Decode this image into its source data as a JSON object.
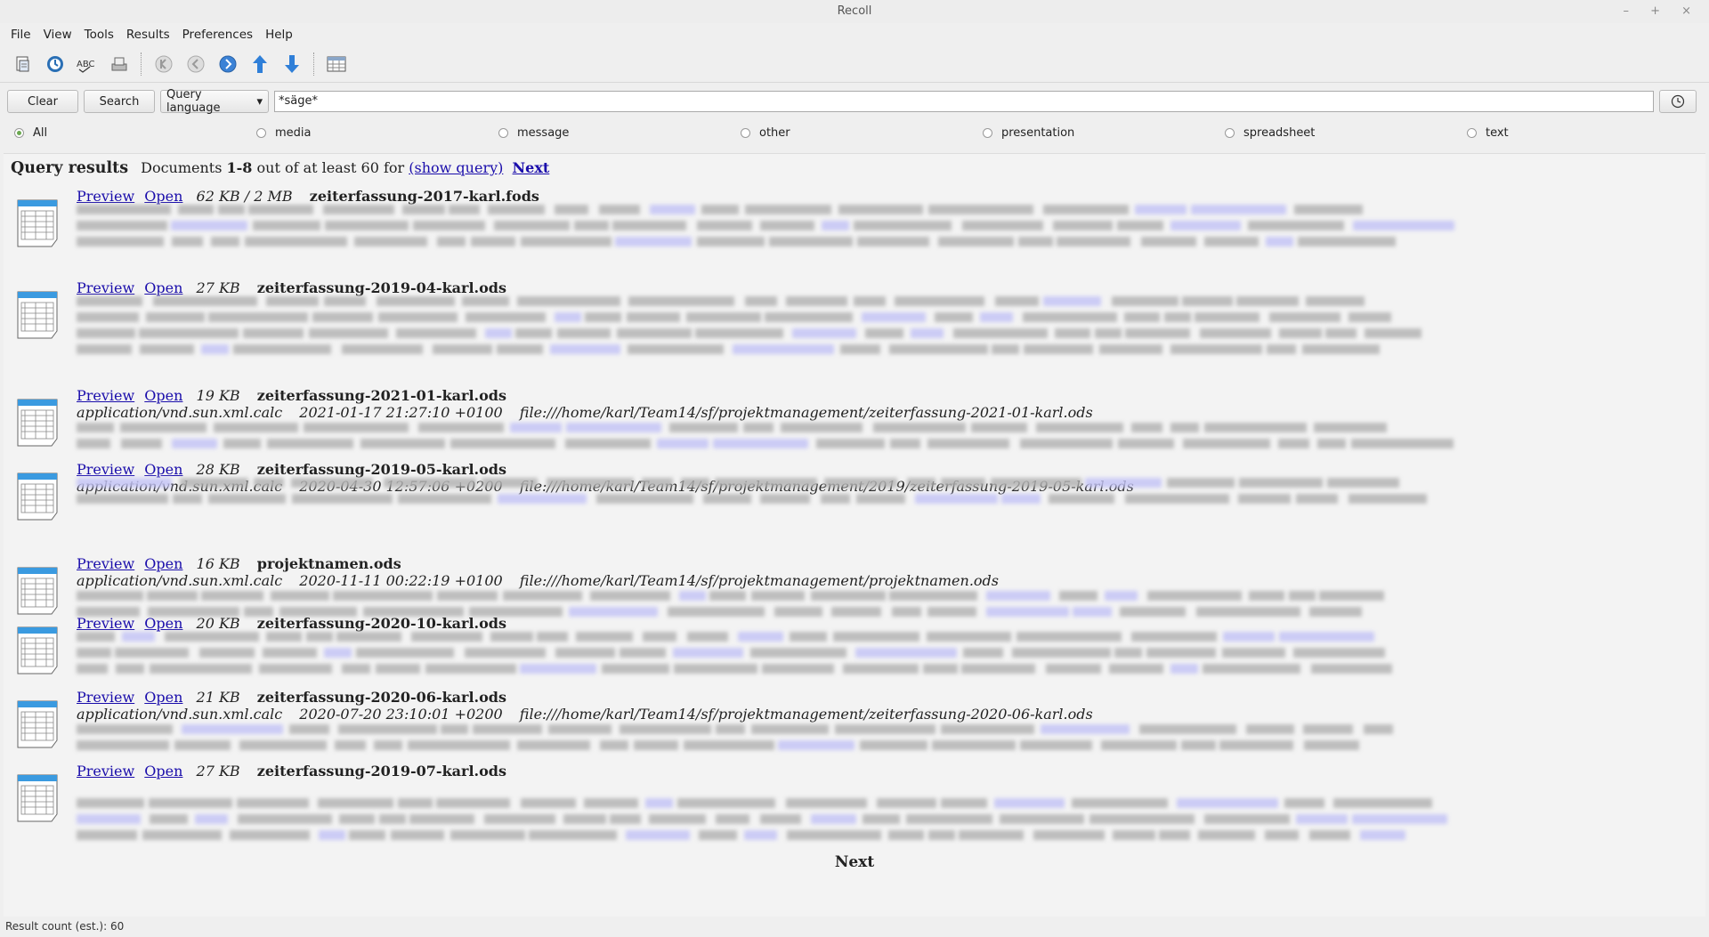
{
  "window": {
    "title": "Recoll",
    "controls": "–  +  ×"
  },
  "menu": [
    "File",
    "View",
    "Tools",
    "Results",
    "Preferences",
    "Help"
  ],
  "toolbar": {
    "icons": [
      "document-history-icon",
      "update-index-icon",
      "spell-icon",
      "query-builder-icon",
      "first-page-icon",
      "previous-page-icon",
      "next-page-icon",
      "sort-up-icon",
      "sort-down-icon",
      "table-view-icon"
    ]
  },
  "search": {
    "clear_label": "Clear",
    "search_label": "Search",
    "mode_value": "Query language",
    "query_value": "*säge*"
  },
  "filters": [
    "All",
    "media",
    "message",
    "other",
    "presentation",
    "spreadsheet",
    "text"
  ],
  "filters_selected": "All",
  "results": {
    "heading": "Query results",
    "summary_pre": "Documents ",
    "summary_range": "1-8",
    "summary_mid": " out of at least 60 for ",
    "show_query": "(show query)",
    "next": "Next",
    "items": [
      {
        "preview": "Preview",
        "open": "Open",
        "size": "62 KB / 2 MB",
        "name": "zeiterfassung-2017-karl.fods",
        "mime": "",
        "date": "",
        "path": ""
      },
      {
        "preview": "Preview",
        "open": "Open",
        "size": "27 KB",
        "name": "zeiterfassung-2019-04-karl.ods",
        "mime": "",
        "date": "",
        "path": ""
      },
      {
        "preview": "Preview",
        "open": "Open",
        "size": "19 KB",
        "name": "zeiterfassung-2021-01-karl.ods",
        "mime": "application/vnd.sun.xml.calc",
        "date": "2021-01-17 21:27:10 +0100",
        "path": "file:///home/karl/Team14/sf/projektmanagement/zeiterfassung-2021-01-karl.ods"
      },
      {
        "preview": "Preview",
        "open": "Open",
        "size": "28 KB",
        "name": "zeiterfassung-2019-05-karl.ods",
        "mime": "application/vnd.sun.xml.calc",
        "date": "2020-04-30 12:57:06 +0200",
        "path": "file:///home/karl/Team14/sf/projektmanagement/2019/zeiterfassung-2019-05-karl.ods"
      },
      {
        "preview": "Preview",
        "open": "Open",
        "size": "16 KB",
        "name": "projektnamen.ods",
        "mime": "application/vnd.sun.xml.calc",
        "date": "2020-11-11 00:22:19 +0100",
        "path": "file:///home/karl/Team14/sf/projektmanagement/projektnamen.ods"
      },
      {
        "preview": "Preview",
        "open": "Open",
        "size": "20 KB",
        "name": "zeiterfassung-2020-10-karl.ods",
        "mime": "",
        "date": "",
        "path": ""
      },
      {
        "preview": "Preview",
        "open": "Open",
        "size": "21 KB",
        "name": "zeiterfassung-2020-06-karl.ods",
        "mime": "application/vnd.sun.xml.calc",
        "date": "2020-07-20 23:10:01 +0200",
        "path": "file:///home/karl/Team14/sf/projektmanagement/zeiterfassung-2020-06-karl.ods"
      },
      {
        "preview": "Preview",
        "open": "Open",
        "size": "27 KB",
        "name": "zeiterfassung-2019-07-karl.ods",
        "mime": "",
        "date": "",
        "path": ""
      }
    ]
  },
  "status": "Result count (est.): 60"
}
